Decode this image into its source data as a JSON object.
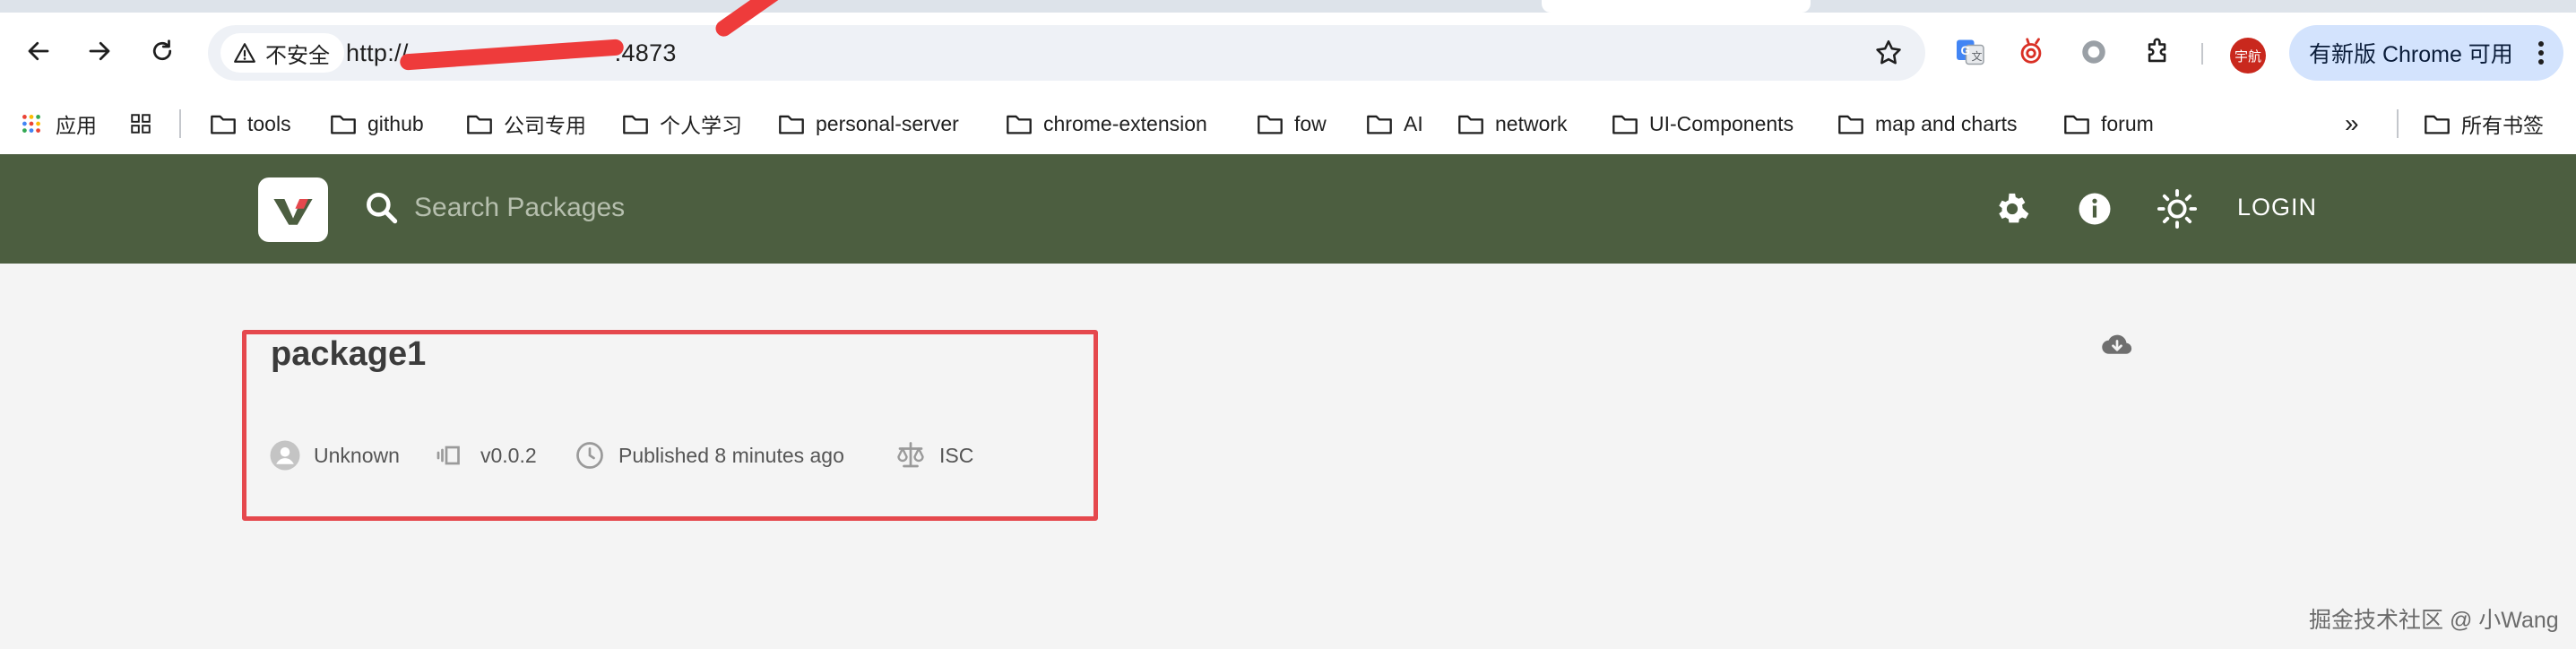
{
  "browser": {
    "security_label": "不安全",
    "url_start": "http://",
    "url_end": ".4873",
    "update_label": "有新版 Chrome 可用",
    "avatar_label": "宇航"
  },
  "bookmarks": {
    "apps_label": "应用",
    "folders": [
      "tools",
      "github",
      "公司专用",
      "个人学习",
      "personal-server",
      "chrome-extension",
      "fow",
      "AI",
      "network",
      "UI-Components",
      "map and charts",
      "forum"
    ],
    "overflow_label": "»",
    "all_label": "所有书签"
  },
  "header": {
    "search_placeholder": "Search Packages",
    "login_label": "LOGIN",
    "color": "#4c5e40"
  },
  "package": {
    "name": "package1",
    "author": "Unknown",
    "version": "v0.0.2",
    "published": "Published 8 minutes ago",
    "license": "ISC"
  },
  "watermark": "掘金技术社区 @ 小Wang"
}
